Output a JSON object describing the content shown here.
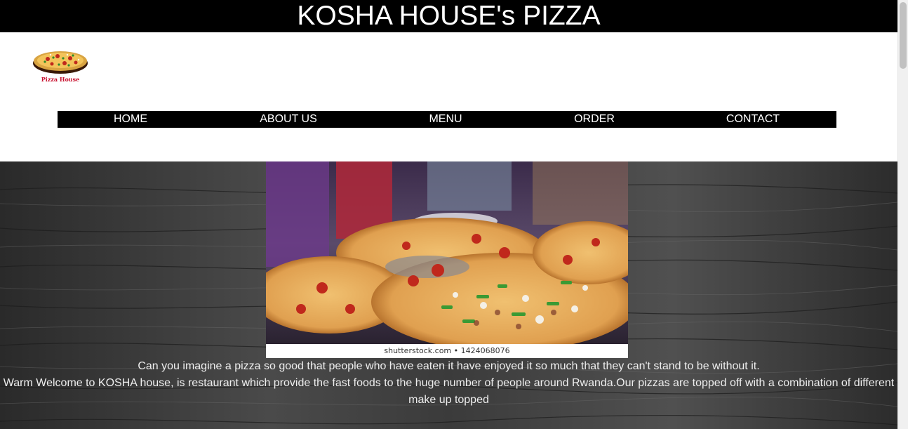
{
  "header": {
    "title": "KOSHA HOUSE's PIZZA"
  },
  "logo": {
    "text": "Pizza House",
    "icon": "pizza-logo-icon"
  },
  "nav": {
    "items": [
      {
        "label": "HOME"
      },
      {
        "label": "ABOUT US"
      },
      {
        "label": "MENU"
      },
      {
        "label": "ORDER"
      },
      {
        "label": "CONTACT"
      }
    ]
  },
  "hero": {
    "photo_caption": "shutterstock.com • 1424068076",
    "tagline": "Can you imagine a pizza so good that people who have eaten it have enjoyed it so much that they can't stand to be without it.",
    "welcome": "Warm Welcome to KOSHA house, is restaurant which provide the fast foods to the huge number of people around Rwanda.Our pizzas are topped off with a combination of different make up topped"
  },
  "colors": {
    "header_bg": "#000000",
    "nav_bg": "#000000",
    "hero_bg": "#3a3a3a",
    "text_light": "#eeeeee"
  }
}
